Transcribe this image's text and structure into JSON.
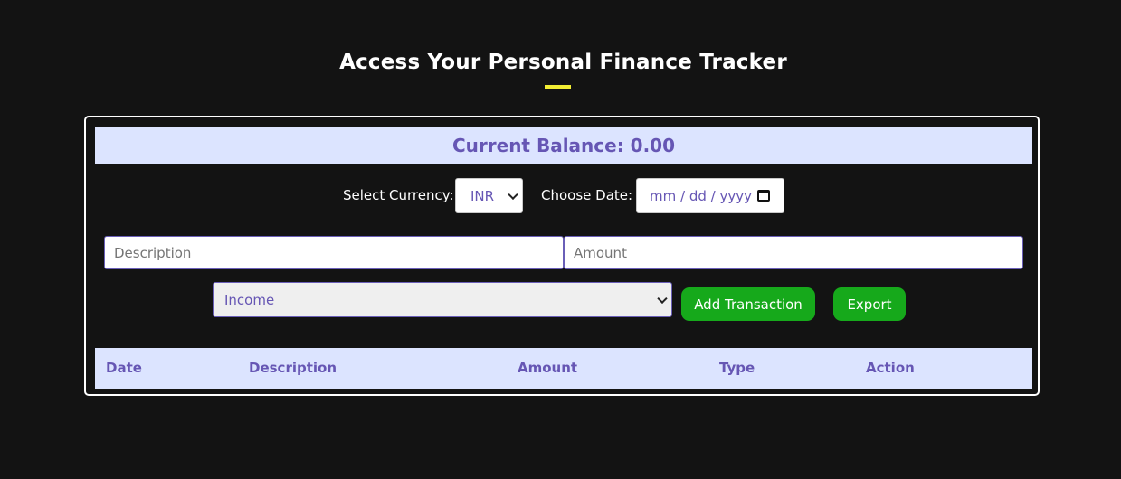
{
  "header": {
    "title": "Access Your Personal Finance Tracker"
  },
  "balance": {
    "label": "Current Balance: 0.00"
  },
  "controls": {
    "currency_label": "Select Currency:",
    "currency_value": "INR",
    "date_label": "Choose Date:",
    "date_placeholder": "mm / dd / yyyy"
  },
  "form": {
    "description_placeholder": "Description",
    "amount_placeholder": "Amount",
    "type_value": "Income",
    "add_button_label": "Add Transaction",
    "export_button_label": "Export"
  },
  "table": {
    "columns": [
      "Date",
      "Description",
      "Amount",
      "Type",
      "Action"
    ]
  },
  "colors": {
    "background": "#131313",
    "accent_underline": "#f2ee33",
    "header_band": "#dce4ff",
    "purple_text": "#6656b4",
    "button_green": "#16a91b"
  },
  "icons": {
    "date_picker": "calendar-icon",
    "select_arrow": "chevron-down-icon"
  }
}
